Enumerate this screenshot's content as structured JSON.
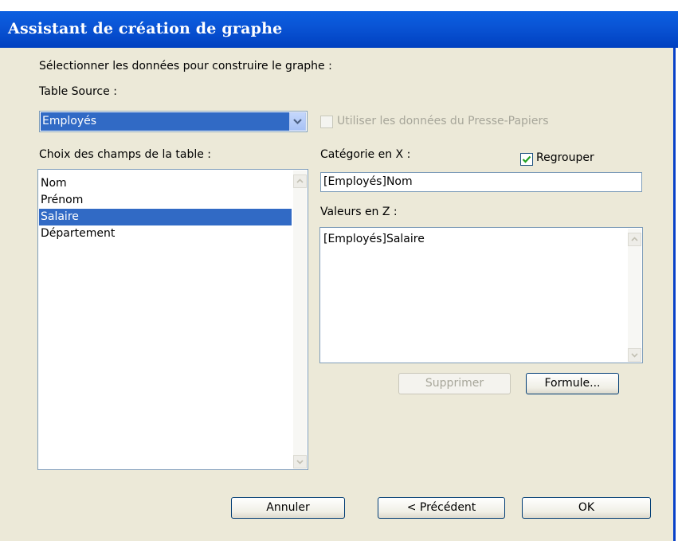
{
  "window": {
    "title": "Assistant de création de graphe"
  },
  "instructions": "Sélectionner les données pour construire le graphe :",
  "source": {
    "label": "Table Source :",
    "selected": "Employés",
    "clipboard_checkbox_label": "Utiliser les données du Presse-Papiers",
    "clipboard_checked": false
  },
  "fields": {
    "label": "Choix des champs de la table :",
    "items": [
      "Nom",
      "Prénom",
      "Salaire",
      "Département"
    ],
    "selected_index": 2
  },
  "category": {
    "label": "Catégorie en X :",
    "value": "[Employés]Nom",
    "group_label": "Regrouper",
    "group_checked": true
  },
  "values": {
    "label": "Valeurs en Z :",
    "items": [
      "[Employés]Salaire"
    ]
  },
  "buttons": {
    "delete": "Supprimer",
    "formula": "Formule...",
    "cancel": "Annuler",
    "previous": "< Précédent",
    "ok": "OK"
  },
  "colors": {
    "titlebar": "#0a55d6",
    "selection": "#316ac5",
    "dialog_bg": "#ece9d8"
  }
}
